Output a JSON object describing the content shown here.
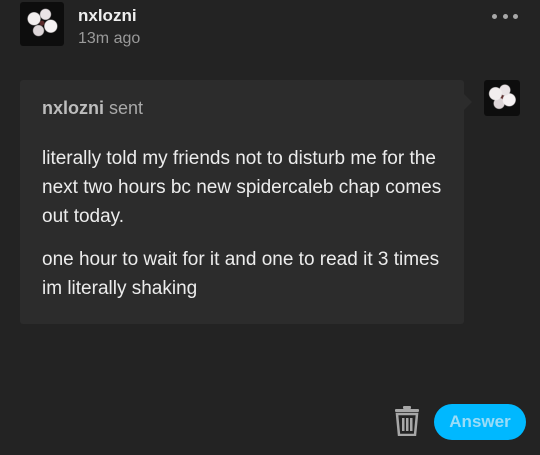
{
  "post": {
    "username": "nxlozni",
    "timestamp": "13m ago",
    "more_icon": "ellipsis-icon"
  },
  "ask": {
    "asker_name": "nxlozni",
    "sent_label": " sent",
    "paragraphs": [
      "literally told my friends not to disturb me for the next two hours bc new spidercaleb chap comes out today.",
      "one hour to wait for it and one to read it 3 times im literally shaking"
    ]
  },
  "actions": {
    "delete_icon": "trash-icon",
    "answer_label": "Answer"
  },
  "colors": {
    "background": "#232323",
    "bubble": "#2c2c2c",
    "accent": "#00b8ff",
    "text_primary": "#ececec",
    "text_secondary": "#9a9a9a"
  }
}
